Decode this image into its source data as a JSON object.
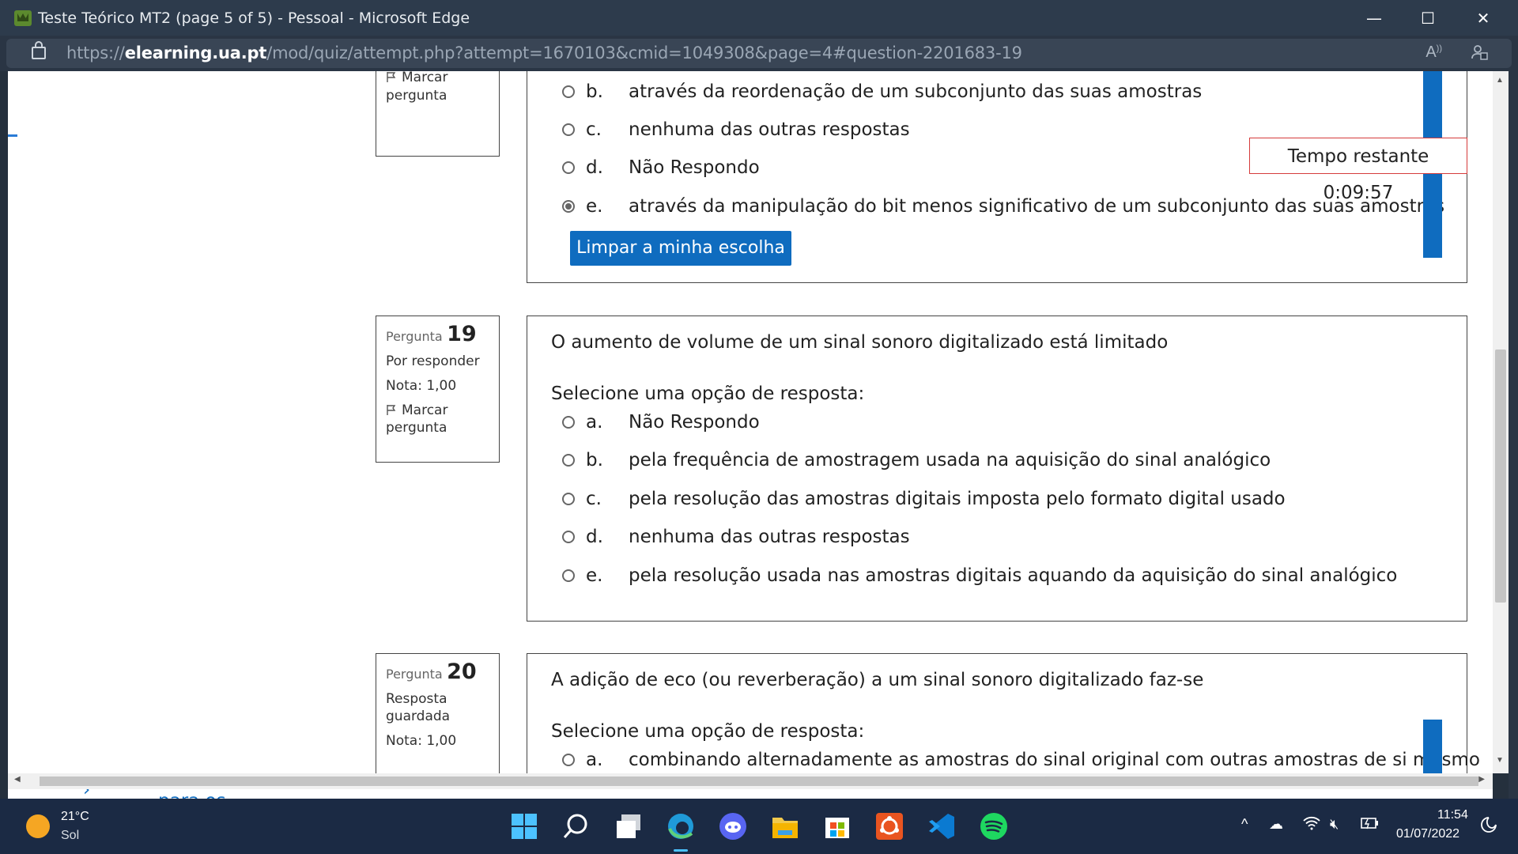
{
  "window": {
    "title": "Teste Teórico MT2 (page 5 of 5) - Pessoal - Microsoft Edge",
    "minimize": "—",
    "maximize": "☐",
    "close": "✕"
  },
  "address": {
    "prefix": "https://",
    "domain": "elearning.ua.pt",
    "path": "/mod/quiz/attempt.php?attempt=1670103&cmid=1049308&page=4#question-2201683-19"
  },
  "timer": {
    "label": "Tempo restante 0:09:57"
  },
  "q18": {
    "flag_partial_top": "Marcar",
    "flag_partial_bottom": "pergunta",
    "options": [
      {
        "letter": "b.",
        "text": "através da reordenação de um subconjunto das suas amostras",
        "checked": false
      },
      {
        "letter": "c.",
        "text": "nenhuma das outras respostas",
        "checked": false
      },
      {
        "letter": "d.",
        "text": "Não Respondo",
        "checked": false
      },
      {
        "letter": "e.",
        "text": "através da manipulação do bit menos significativo de um subconjunto das suas amostras",
        "checked": true
      }
    ],
    "clear_button": "Limpar a minha escolha"
  },
  "q19": {
    "label": "Pergunta",
    "number": "19",
    "status": "Por responder",
    "grade": "Nota: 1,00",
    "flag1": "Marcar",
    "flag2": "pergunta",
    "question": "O aumento de volume de um sinal sonoro digitalizado está limitado",
    "prompt": "Selecione uma opção de resposta:",
    "options": [
      {
        "letter": "a.",
        "text": "Não Respondo",
        "checked": false
      },
      {
        "letter": "b.",
        "text": "pela frequência de amostragem usada na aquisição do sinal analógico",
        "checked": false
      },
      {
        "letter": "c.",
        "text": "pela resolução das amostras digitais imposta pelo formato digital usado",
        "checked": false
      },
      {
        "letter": "d.",
        "text": "nenhuma das outras respostas",
        "checked": false
      },
      {
        "letter": "e.",
        "text": "pela resolução usada nas amostras digitais aquando da aquisição do sinal analógico",
        "checked": false
      }
    ]
  },
  "q20": {
    "label": "Pergunta",
    "number": "20",
    "status1": "Resposta",
    "status2": "guardada",
    "grade": "Nota: 1,00",
    "question": "A adição de eco (ou reverberação) a um sinal sonoro digitalizado faz-se",
    "prompt": "Selecione uma opção de resposta:",
    "options": [
      {
        "letter": "a.",
        "text": "combinando alternadamente as amostras do sinal original com outras amostras de si mesmo",
        "checked": false
      }
    ]
  },
  "footer_peek": "Ferramentas para os",
  "taskbar": {
    "weather_temp": "21°C",
    "weather_desc": "Sol",
    "time": "11:54",
    "date": "01/07/2022",
    "icons": [
      "start-icon",
      "search-icon",
      "task-view-icon",
      "edge-icon",
      "discord-icon",
      "file-explorer-icon",
      "store-icon",
      "ubuntu-icon",
      "vscode-icon",
      "spotify-icon"
    ]
  }
}
